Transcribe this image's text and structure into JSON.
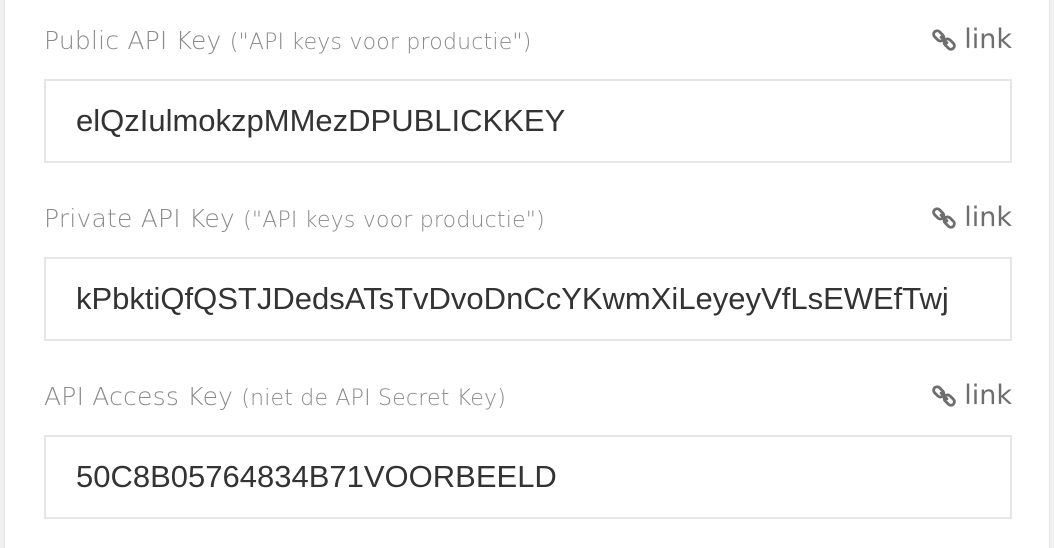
{
  "fields": [
    {
      "label": "Public API Key",
      "hint": "(\"API keys voor productie\")",
      "link_text": "link",
      "value": "elQzIulmokzpMMezDPUBLICKKEY"
    },
    {
      "label": "Private API Key",
      "hint": "(\"API keys voor productie\")",
      "link_text": "link",
      "value": "kPbktiQfQSTJDedsATsTvDvoDnCcYKwmXiLeyeyVfLsEWEfTwj"
    },
    {
      "label": "API Access Key",
      "hint": "(niet de API Secret Key)",
      "link_text": "link",
      "value": "50C8B05764834B71VOORBEELD"
    }
  ],
  "icons": {
    "link": "link-icon"
  },
  "colors": {
    "label": "#8a8a8a",
    "link": "#6e6e6e",
    "input_text": "#333333",
    "input_border": "#e6e6e6"
  }
}
